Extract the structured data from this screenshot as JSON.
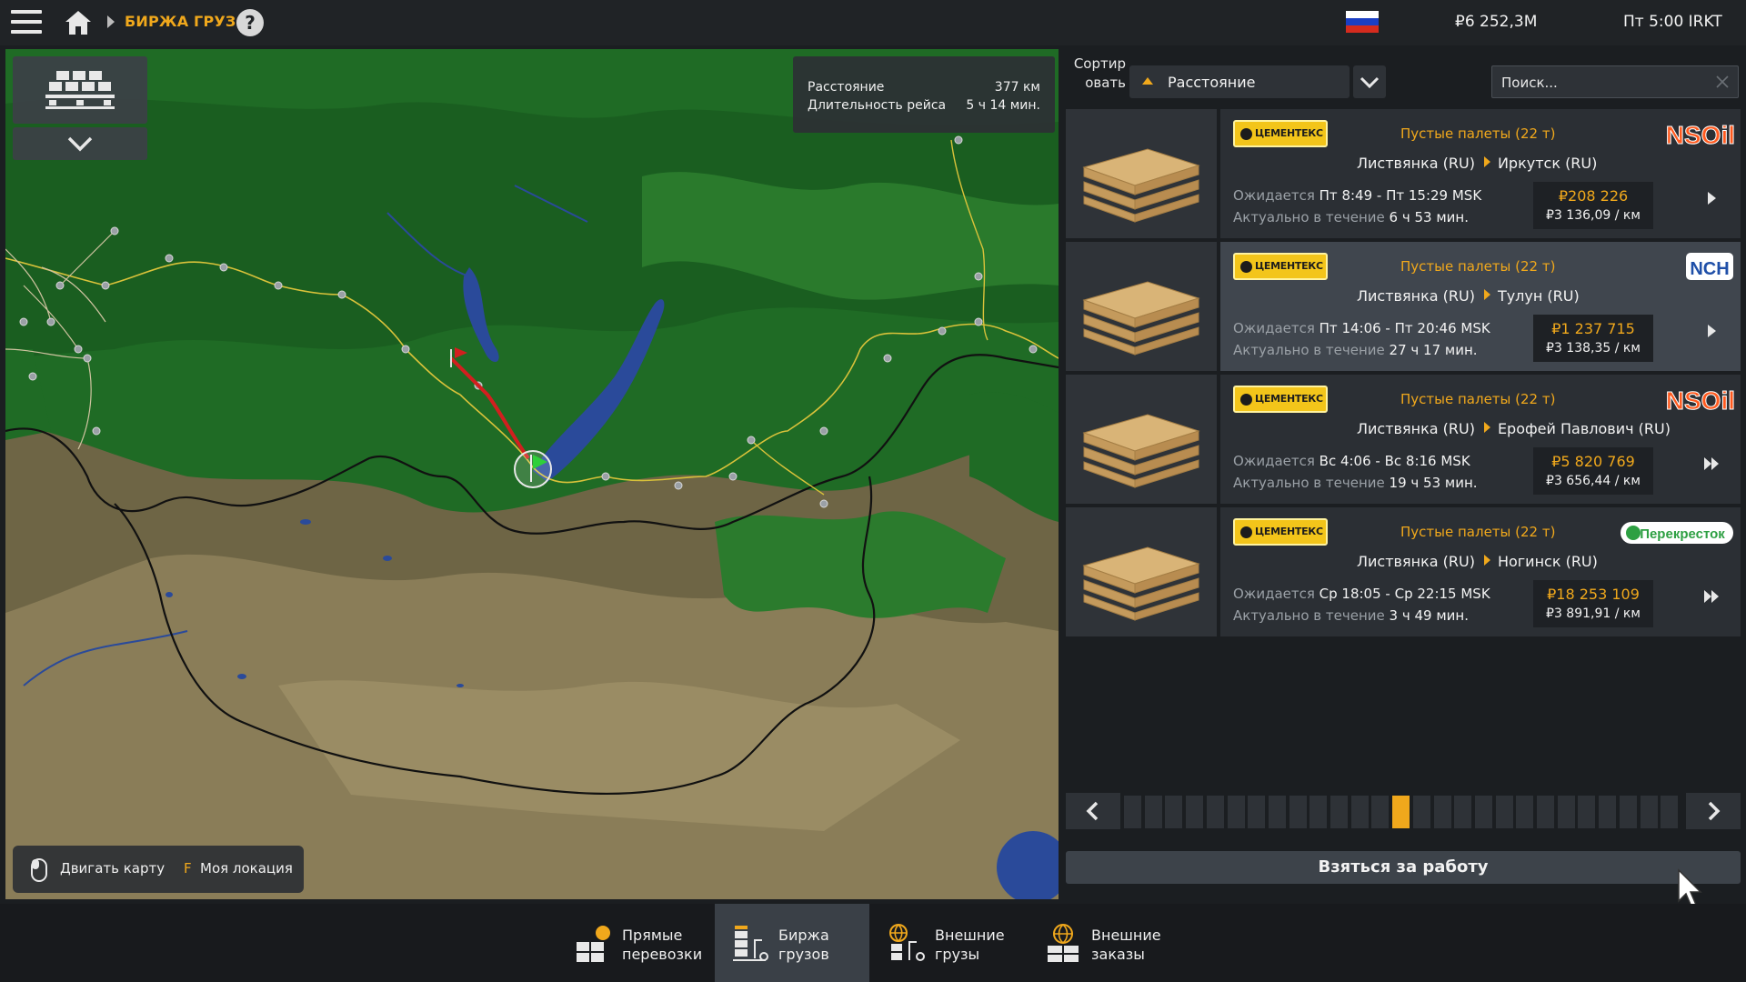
{
  "topbar": {
    "breadcrumb": "БИРЖА ГРУЗОВ",
    "help": "?",
    "money": "₽6 252,3M",
    "clock": "Пт 5:00 IRKT"
  },
  "map": {
    "distance_label": "Расстояние",
    "distance_value": "377 км",
    "duration_label": "Длительность рейса",
    "duration_value": "5 ч 14 мин.",
    "hint_move": "Двигать карту",
    "hint_key": "F",
    "hint_location": "Моя локация"
  },
  "sort": {
    "label": "Сортир овать",
    "value": "Расстояние"
  },
  "search": {
    "placeholder": "Поиск..."
  },
  "jobs": [
    {
      "company": "ЦЕМЕНТЕКС",
      "cargo": "Пустые палеты (22 т)",
      "logo": "NSOil",
      "from": "Листвянка (RU)",
      "to": "Иркутск (RU)",
      "expected_label": "Ожидается",
      "expected": "Пт 8:49 - Пт 15:29 MSK",
      "valid_label": "Актуально в течение",
      "valid": "6 ч 53 мин.",
      "pay": "₽208 226",
      "per_km": "₽3 136,09 / км"
    },
    {
      "company": "ЦЕМЕНТЕКС",
      "cargo": "Пустые палеты (22 т)",
      "logo": "NCH",
      "from": "Листвянка (RU)",
      "to": "Тулун (RU)",
      "expected_label": "Ожидается",
      "expected": "Пт 14:06 - Пт 20:46 MSK",
      "valid_label": "Актуально в течение",
      "valid": "27 ч 17 мин.",
      "pay": "₽1 237 715",
      "per_km": "₽3 138,35 / км"
    },
    {
      "company": "ЦЕМЕНТЕКС",
      "cargo": "Пустые палеты (22 т)",
      "logo": "NSOil",
      "from": "Листвянка (RU)",
      "to": "Ерофей Павлович (RU)",
      "expected_label": "Ожидается",
      "expected": "Вс 4:06 - Вс 8:16 MSK",
      "valid_label": "Актуально в течение",
      "valid": "19 ч 53 мин.",
      "pay": "₽5 820 769",
      "per_km": "₽3 656,44 / км"
    },
    {
      "company": "ЦЕМЕНТЕКС",
      "cargo": "Пустые палеты (22 т)",
      "logo": "Перекресток",
      "from": "Листвянка (RU)",
      "to": "Ногинск (RU)",
      "expected_label": "Ожидается",
      "expected": "Ср 18:05 - Ср 22:15 MSK",
      "valid_label": "Актуально в течение",
      "valid": "3 ч 49 мин.",
      "pay": "₽18 253 109",
      "per_km": "₽3 891,91 / км"
    }
  ],
  "pager": {
    "total_pages": 27,
    "current_page": 14
  },
  "take_button": "Взяться за работу",
  "bottom_tabs": [
    {
      "label": "Прямые\nперевозки",
      "icon": "direct-delivery-icon"
    },
    {
      "label": "Биржа\nгрузов",
      "icon": "freight-market-icon"
    },
    {
      "label": "Внешние\nгрузы",
      "icon": "external-cargo-icon"
    },
    {
      "label": "Внешние\nзаказы",
      "icon": "external-orders-icon"
    }
  ],
  "colors": {
    "accent": "#f0a81c",
    "panel": "#2b2f34",
    "active_row": "#40464e",
    "route": "#d21f1f"
  }
}
